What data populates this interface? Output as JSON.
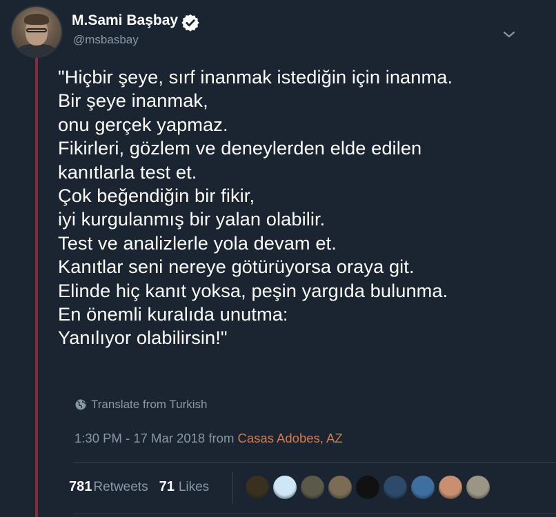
{
  "author": {
    "display_name": "M.Sami Başbay",
    "handle": "@msbasbay",
    "verified": true
  },
  "tweet": {
    "lines": [
      "\"Hiçbir şeye, sırf inanmak istediğin için inanma.",
      "Bir şeye inanmak,",
      "onu gerçek yapmaz.",
      "Fikirleri, gözlem ve deneylerden elde edilen",
      "kanıtlarla test et.",
      "Çok beğendiğin bir fikir,",
      "iyi kurgulanmış bir yalan olabilir.",
      "Test ve analizlerle yola devam et.",
      "Kanıtlar seni nereye götürüyorsa oraya git.",
      "Elinde hiç kanıt yoksa, peşin yargıda bulunma.",
      "En önemli kuralıda unutma:",
      "Yanılıyor olabilirsin!\""
    ],
    "translate_label": "Translate from Turkish",
    "time": "1:30 PM - 17 Mar 2018 from ",
    "location": "Casas Adobes, AZ"
  },
  "stats": {
    "retweets_count": "781",
    "retweets_label": "Retweets",
    "likes_count": "71",
    "likes_label": "Likes"
  },
  "likers": [
    {
      "icon": "liker-avatar",
      "color": "#3a3020"
    },
    {
      "icon": "liker-avatar",
      "color": "#cfe6f7"
    },
    {
      "icon": "liker-avatar",
      "color": "#5b5a4a"
    },
    {
      "icon": "liker-avatar",
      "color": "#7a6c55"
    },
    {
      "icon": "liker-avatar",
      "color": "#111111"
    },
    {
      "icon": "liker-avatar",
      "color": "#2d4a6a"
    },
    {
      "icon": "liker-avatar",
      "color": "#3e6fa0"
    },
    {
      "icon": "liker-avatar",
      "color": "#c89070"
    },
    {
      "icon": "liker-avatar",
      "color": "#9a9585"
    }
  ],
  "colors": {
    "background": "#1b2431",
    "thread_line": "#7f2e3a",
    "secondary_text": "#8899a6",
    "location_link": "#d57a4e"
  }
}
